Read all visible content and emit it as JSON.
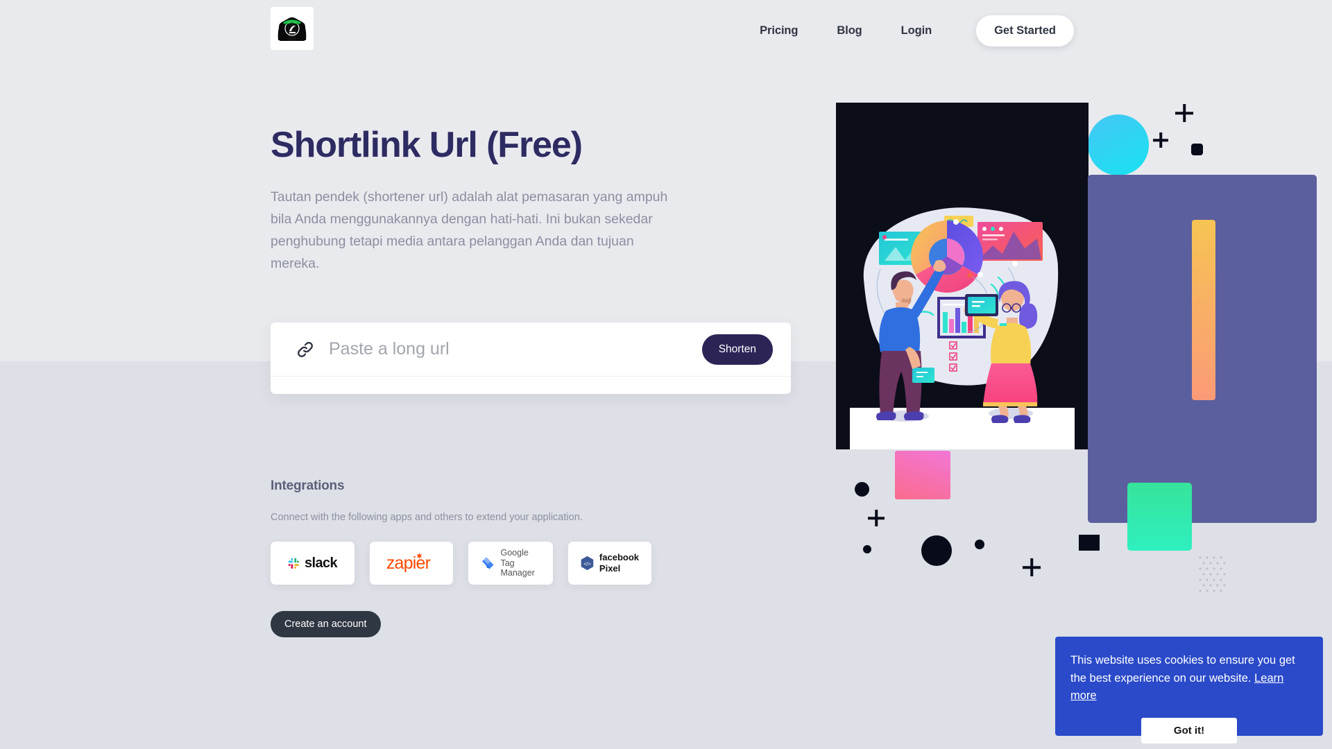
{
  "header": {
    "logo_alt": "brand-logo",
    "nav": [
      {
        "label": "Pricing",
        "name": "nav-link-pricing"
      },
      {
        "label": "Blog",
        "name": "nav-link-blog"
      },
      {
        "label": "Login",
        "name": "nav-link-login"
      }
    ],
    "cta_label": "Get Started"
  },
  "hero": {
    "title": "Shortlink Url (Free)",
    "subtitle": "Tautan pendek (shortener url) adalah alat pemasaran yang ampuh bila Anda menggunakannya dengan hati-hati. Ini bukan sekedar penghubung tetapi media antara pelanggan Anda dan tujuan mereka."
  },
  "shortener": {
    "placeholder": "Paste a long url",
    "value": "",
    "button_label": "Shorten",
    "icon": "link-icon"
  },
  "integrations": {
    "title": "Integrations",
    "description": "Connect with the following apps and others to extend your application.",
    "apps": [
      {
        "name": "slack",
        "label": "slack"
      },
      {
        "name": "zapier",
        "label": "zapier"
      },
      {
        "name": "google-tag-manager",
        "label": "Google",
        "label2": "Tag Manager"
      },
      {
        "name": "facebook-pixel",
        "label": "facebook",
        "label2": "Pixel"
      }
    ],
    "create_account_label": "Create an account"
  },
  "cookie_banner": {
    "message": "This website uses cookies to ensure you get the best experience on our website.",
    "learn_more_label": "Learn more",
    "accept_label": "Got it!",
    "background": "#2a4ac9"
  },
  "colors": {
    "page_bg_top": "#e9eaee",
    "page_bg_bottom": "#dde0e6",
    "heading": "#2d2b62",
    "body_text": "#8a8fa0",
    "primary_button": "#2d2456",
    "dark_button": "#2f3743",
    "cookie_blue": "#2a4ac9"
  }
}
